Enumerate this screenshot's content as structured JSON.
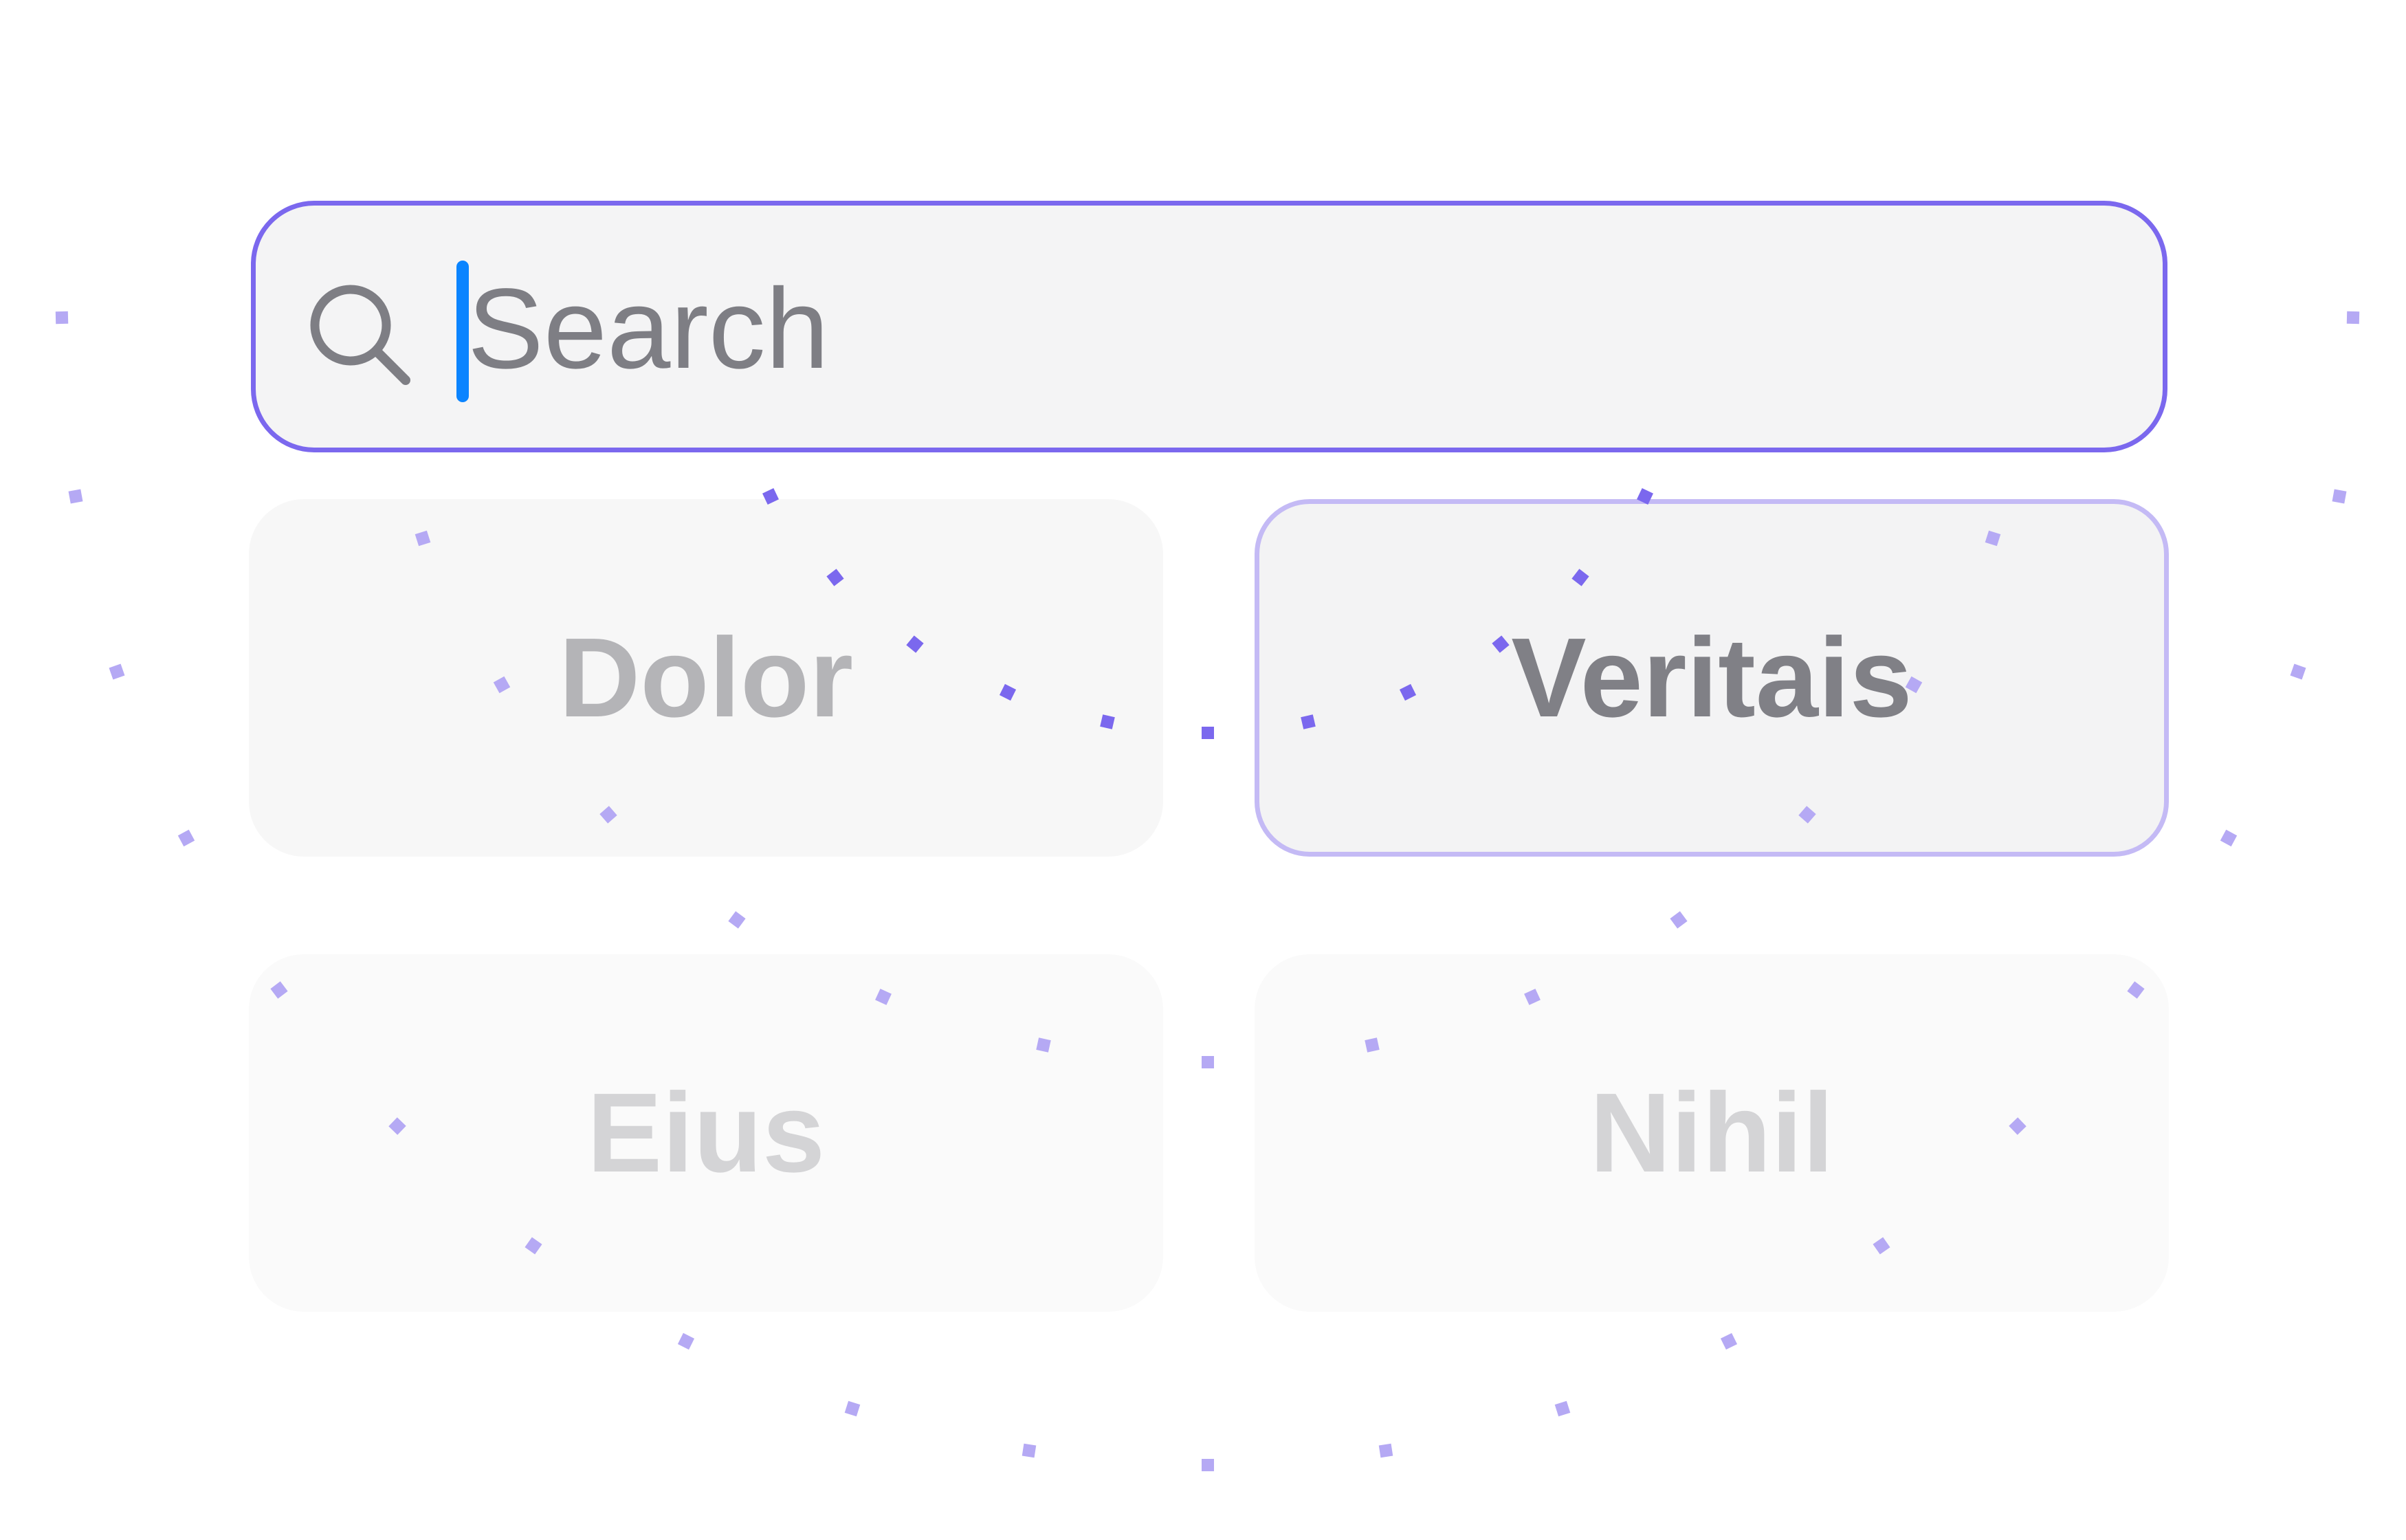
{
  "search": {
    "placeholder": "Search",
    "value": "",
    "border_color": "#7B68EE",
    "caret_color": "#0A84FF",
    "icon": "search-icon"
  },
  "results": [
    {
      "label": "Dolor",
      "state": "dimmed"
    },
    {
      "label": "Veritais",
      "state": "highlighted"
    },
    {
      "label": "Eius",
      "state": "faded"
    },
    {
      "label": "Nihil",
      "state": "faded"
    }
  ],
  "colors": {
    "accent": "#7B68EE",
    "highlight_border": "#c4baf5",
    "dot_strong": "#7B68EE",
    "dot_light": "#b5a9f4"
  }
}
